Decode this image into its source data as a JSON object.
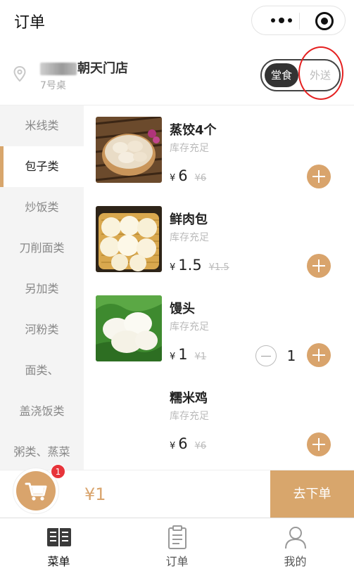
{
  "header": {
    "title": "订单"
  },
  "store": {
    "name": "朝天门店",
    "table": "7号桌"
  },
  "mode_toggle": {
    "dine_in": "堂食",
    "takeout": "外送",
    "selected": "dine_in"
  },
  "categories": [
    "米线类",
    "包子类",
    "炒饭类",
    "刀削面类",
    "另加类",
    "河粉类",
    "面类、",
    "盖浇饭类",
    "粥类、蒸菜"
  ],
  "active_category": "包子类",
  "products": [
    {
      "name": "蒸饺4个",
      "stock": "库存充足",
      "currency": "¥",
      "price": "6",
      "original_price": "¥6",
      "quantity": null
    },
    {
      "name": "鲜肉包",
      "stock": "库存充足",
      "currency": "¥",
      "price": "1.5",
      "original_price": "¥1.5",
      "quantity": null
    },
    {
      "name": "馒头",
      "stock": "库存充足",
      "currency": "¥",
      "price": "1",
      "original_price": "¥1",
      "quantity": "1"
    },
    {
      "name": "糯米鸡",
      "stock": "库存充足",
      "currency": "¥",
      "price": "6",
      "original_price": "¥6",
      "quantity": null
    }
  ],
  "cart": {
    "count": "1",
    "total": "¥1",
    "checkout_label": "去下单"
  },
  "tabs": [
    {
      "label": "菜单",
      "icon": "menu-book-icon"
    },
    {
      "label": "订单",
      "icon": "clipboard-icon"
    },
    {
      "label": "我的",
      "icon": "user-icon"
    }
  ],
  "colors": {
    "accent": "#d8a66c",
    "badge": "#e7343a",
    "annotation": "#e52020"
  }
}
